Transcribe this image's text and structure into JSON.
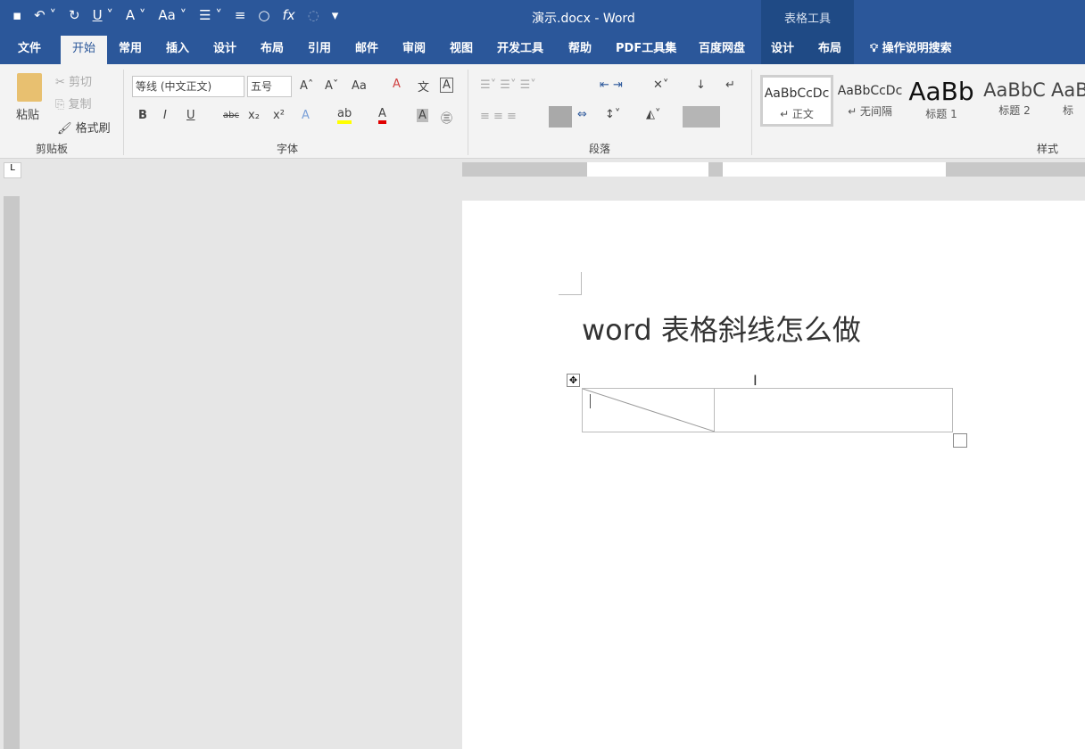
{
  "window": {
    "title": "演示.docx  -  Word",
    "context_tab_group": "表格工具"
  },
  "qat": {
    "icons": [
      "save-icon",
      "undo-icon",
      "redo-icon",
      "underline-icon",
      "text-effect-icon",
      "change-case-icon",
      "bullets-icon",
      "align-icon",
      "shape-icon",
      "formula-icon",
      "comment-icon",
      "customize-icon"
    ]
  },
  "tabs": [
    {
      "label": "文件"
    },
    {
      "label": "开始"
    },
    {
      "label": "常用"
    },
    {
      "label": "插入"
    },
    {
      "label": "设计"
    },
    {
      "label": "布局"
    },
    {
      "label": "引用"
    },
    {
      "label": "邮件"
    },
    {
      "label": "审阅"
    },
    {
      "label": "视图"
    },
    {
      "label": "开发工具"
    },
    {
      "label": "帮助"
    },
    {
      "label": "PDF工具集"
    },
    {
      "label": "百度网盘"
    },
    {
      "label": "设计"
    },
    {
      "label": "布局"
    }
  ],
  "search": {
    "label": "操作说明搜索"
  },
  "clipboard": {
    "paste": "粘贴",
    "cut": "剪切",
    "copy": "复制",
    "format_painter": "格式刷",
    "group": "剪贴板"
  },
  "font": {
    "name": "等线 (中文正文)",
    "size": "五号",
    "group": "字体",
    "bold": "B",
    "italic": "I",
    "underline": "U",
    "strike": "abc",
    "sub": "x₂",
    "sup": "x²",
    "case": "Aa"
  },
  "paragraph": {
    "group": "段落"
  },
  "styles": {
    "group": "样式",
    "items": [
      {
        "sample": "AaBbCcDc",
        "name": "↵ 正文"
      },
      {
        "sample": "AaBbCcDc",
        "name": "↵ 无间隔"
      },
      {
        "sample": "AaBb",
        "name": "标题 1"
      },
      {
        "sample": "AaBbC",
        "name": "标题 2"
      },
      {
        "sample": "AaB",
        "name": "标"
      }
    ]
  },
  "document": {
    "heading": "word 表格斜线怎么做"
  },
  "colors": {
    "accent": "#2b579a",
    "highlight": "#ffff00",
    "font_color": "#e00000"
  }
}
